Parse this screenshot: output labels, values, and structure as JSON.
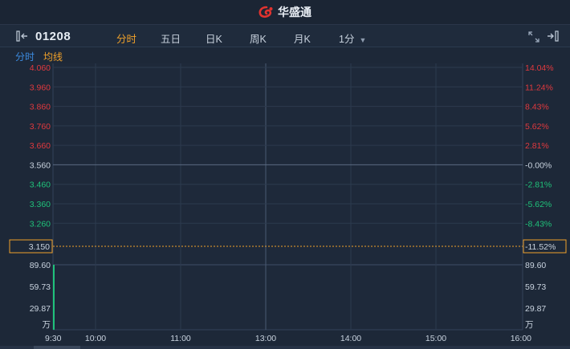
{
  "brand": {
    "name": "华盛通"
  },
  "stock": {
    "code": "01208"
  },
  "toolbar": {
    "tabs": [
      {
        "label": "分时",
        "active": true
      },
      {
        "label": "五日",
        "active": false
      },
      {
        "label": "日K",
        "active": false
      },
      {
        "label": "周K",
        "active": false
      },
      {
        "label": "月K",
        "active": false
      },
      {
        "label": "1分",
        "active": false,
        "dropdown": true
      }
    ]
  },
  "legend": {
    "time_share": "分时",
    "avg_line": "均线"
  },
  "chart_data": {
    "type": "line",
    "prev_close": 3.56,
    "price_axis": {
      "left_ticks": [
        "4.060",
        "3.960",
        "3.860",
        "3.760",
        "3.660",
        "3.560",
        "3.460",
        "3.360",
        "3.260"
      ],
      "tick_values": [
        4.06,
        3.96,
        3.86,
        3.76,
        3.66,
        3.56,
        3.46,
        3.36,
        3.26
      ],
      "right_ticks": [
        "14.04%",
        "11.24%",
        "8.43%",
        "5.62%",
        "2.81%",
        "-0.00%",
        "-2.81%",
        "-5.62%",
        "-8.43%"
      ],
      "range": [
        3.15,
        4.06
      ]
    },
    "current": {
      "price_label": "3.150",
      "change_label": "-11.52%",
      "value": 3.15
    },
    "volume_axis": {
      "ticks": [
        "89.60",
        "59.73",
        "29.87"
      ],
      "tick_values": [
        89.6,
        59.73,
        29.87
      ],
      "unit": "万",
      "max": 89.6
    },
    "x_axis": {
      "ticks": [
        "9:30",
        "10:00",
        "11:00",
        "13:00",
        "14:00",
        "15:00",
        "16:00"
      ]
    },
    "volume_bars": [
      {
        "time": "9:30",
        "value": 89.6
      }
    ],
    "colors": {
      "up": "#e0393e",
      "down": "#1fc27a",
      "neutral": "#c9d3df",
      "avg": "#f0a12a",
      "volume": "#1fc27a"
    }
  }
}
